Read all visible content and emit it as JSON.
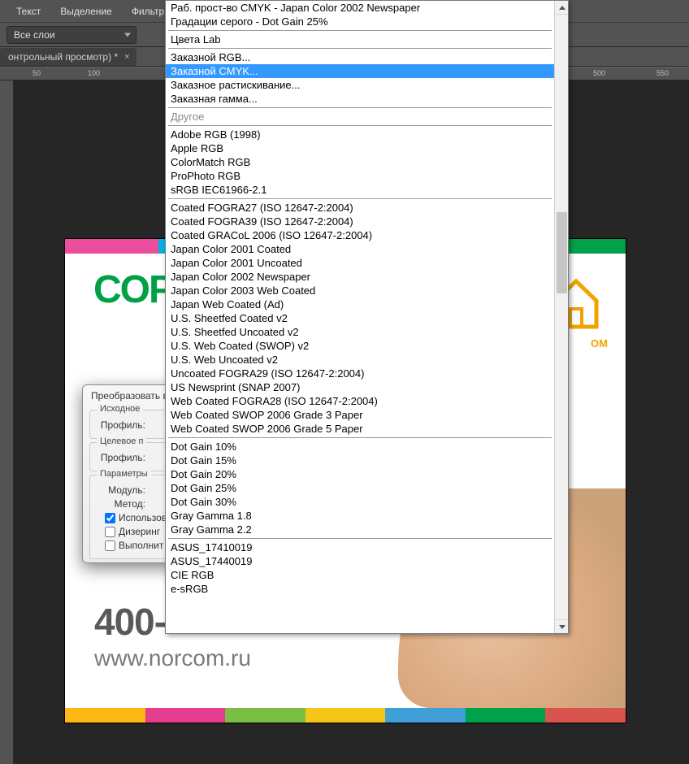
{
  "menu": {
    "items": [
      "Текст",
      "Выделение",
      "Фильтр"
    ]
  },
  "toolbar": {
    "layers_dropdown": "Все слои"
  },
  "tab": {
    "title": "онтрольный просмотр) *"
  },
  "ruler": {
    "labels": [
      "50",
      "100",
      "500",
      "550"
    ]
  },
  "canvas": {
    "logo_text": "COP",
    "phone": "400-",
    "url": "www.norcom.ru",
    "house_label": "OM",
    "stripe_colors_top": [
      "#ea4e9c",
      "#00b1e6",
      "#ffd400",
      "#7abf43",
      "#3fa0d9",
      "#00a14b"
    ],
    "stripe_colors_bot": [
      "#fdb813",
      "#e53c8d",
      "#7abf43",
      "#f5c518",
      "#3fa0d9",
      "#00a14b",
      "#d9534f"
    ]
  },
  "dialog": {
    "title": "Преобразовать в",
    "group_source": "Исходное",
    "group_target": "Целевое п",
    "group_params": "Параметры",
    "label_profile": "Профиль:",
    "label_module": "Модуль:",
    "label_method": "Метод:",
    "chk_use": "Использов",
    "chk_dither": "Дизеринг",
    "chk_flatten": "Выполнит"
  },
  "profile_menu": {
    "sections": [
      {
        "items": [
          "Раб. прост-во CMYK - Japan Color 2002 Newspaper",
          "Градации серого - Dot Gain 25%"
        ]
      },
      {
        "items": [
          "Цвета Lab"
        ]
      },
      {
        "items": [
          "Заказной RGB...",
          {
            "label": "Заказной CMYK...",
            "highlighted": true
          },
          "Заказное растискивание...",
          "Заказная гамма..."
        ]
      },
      {
        "heading": "Другое"
      },
      {
        "items": [
          "Adobe RGB (1998)",
          "Apple RGB",
          "ColorMatch RGB",
          "ProPhoto RGB",
          "sRGB IEC61966-2.1"
        ]
      },
      {
        "items": [
          "Coated FOGRA27 (ISO 12647-2:2004)",
          "Coated FOGRA39 (ISO 12647-2:2004)",
          "Coated GRACoL 2006 (ISO 12647-2:2004)",
          "Japan Color 2001 Coated",
          "Japan Color 2001 Uncoated",
          "Japan Color 2002 Newspaper",
          "Japan Color 2003 Web Coated",
          "Japan Web Coated (Ad)",
          "U.S. Sheetfed Coated v2",
          "U.S. Sheetfed Uncoated v2",
          "U.S. Web Coated (SWOP) v2",
          "U.S. Web Uncoated v2",
          "Uncoated FOGRA29 (ISO 12647-2:2004)",
          "US Newsprint (SNAP 2007)",
          "Web Coated FOGRA28 (ISO 12647-2:2004)",
          "Web Coated SWOP 2006 Grade 3 Paper",
          "Web Coated SWOP 2006 Grade 5 Paper"
        ]
      },
      {
        "items": [
          "Dot Gain 10%",
          "Dot Gain 15%",
          "Dot Gain 20%",
          "Dot Gain 25%",
          "Dot Gain 30%",
          "Gray Gamma 1.8",
          "Gray Gamma 2.2"
        ]
      },
      {
        "items": [
          "ASUS_17410019",
          "ASUS_17440019",
          "CIE RGB",
          "e-sRGB"
        ]
      }
    ]
  }
}
